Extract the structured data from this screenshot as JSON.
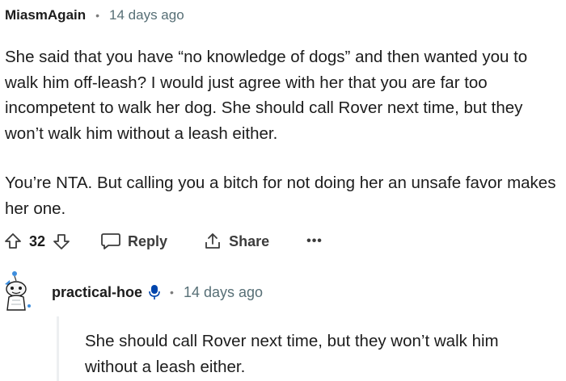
{
  "comment": {
    "username": "MiasmAgain",
    "separator": "•",
    "timestamp": "14 days ago",
    "paragraphs": [
      "She said that you have “no knowledge of dogs” and then wanted you to walk him off-leash? I would just agree with her that you are far too incompetent to walk her dog. She should call Rover next time, but they won’t walk him without a leash either.",
      "You’re NTA. But calling you a bitch for not doing her an unsafe favor makes her one."
    ],
    "actions": {
      "vote_count": "32",
      "reply_label": "Reply",
      "share_label": "Share",
      "more_label": "•••"
    }
  },
  "reply": {
    "username": "practical-hoe",
    "separator": "•",
    "timestamp": "14 days ago",
    "quote_text": "She should call Rover next time, but they won’t walk him without a leash either."
  },
  "icons": {
    "upvote": "upvote-arrow-icon",
    "downvote": "downvote-arrow-icon",
    "reply": "speech-bubble-icon",
    "share": "share-upload-icon",
    "mic": "microphone-icon",
    "avatar": "snoo-avatar"
  },
  "colors": {
    "text": "#1c1c1c",
    "meta": "#576f76",
    "mic": "#0045ac",
    "avatar_accent": "#3e8ede"
  }
}
